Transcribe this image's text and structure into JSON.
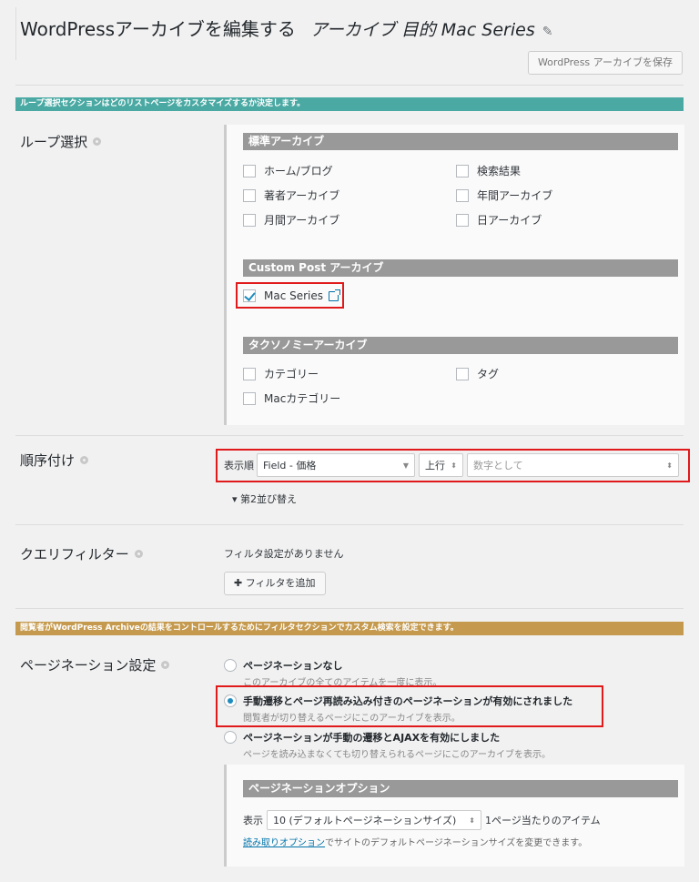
{
  "header": {
    "title": "WordPressアーカイブを編集する",
    "subtitle": "アーカイブ 目的 Mac Series",
    "save_label": "WordPress アーカイブを保存"
  },
  "banners": {
    "loop": "ループ選択セクションはどのリストページをカスタマイズするか決定します。",
    "filter": "閲覧者がWordPress Archiveの結果をコントロールするためにフィルタセクションでカスタム検索を設定できます。"
  },
  "loop": {
    "label": "ループ選択",
    "standard_head": "標準アーカイブ",
    "standard_items": [
      "ホーム/ブログ",
      "検索結果",
      "著者アーカイブ",
      "年間アーカイブ",
      "月間アーカイブ",
      "日アーカイブ"
    ],
    "custom_head": "Custom Post アーカイブ",
    "custom_item": "Mac Series",
    "taxonomy_head": "タクソノミーアーカイブ",
    "taxonomy_items": [
      "カテゴリー",
      "タグ",
      "Macカテゴリー"
    ]
  },
  "order": {
    "label": "順序付け",
    "order_by_label": "表示順",
    "field_value": "Field - 価格",
    "direction": "上行",
    "as_type": "数字として",
    "secondary_sort": "▾ 第2並び替え"
  },
  "filter": {
    "label": "クエリフィルター",
    "none_text": "フィルタ設定がありません",
    "add_label": "✚ フィルタを追加"
  },
  "pagination": {
    "label": "ページネーション設定",
    "options": [
      {
        "title": "ページネーションなし",
        "desc": "このアーカイブの全てのアイテムを一度に表示。"
      },
      {
        "title": "手動遷移とページ再読み込み付きのページネーションが有効にされました",
        "desc": "閲覧者が切り替えるページにこのアーカイブを表示。"
      },
      {
        "title": "ページネーションが手動の遷移とAJAXを有効にしました",
        "desc": "ページを読み込まなくても切り替えられるページにこのアーカイブを表示。"
      }
    ],
    "options_head": "ページネーションオプション",
    "show_label": "表示",
    "page_size": "10 (デフォルトページネーションサイズ)",
    "per_page_label": "1ページ当たりのアイテム",
    "reading_link": "読み取りオプション",
    "reading_note": "でサイトのデフォルトページネーションサイズを変更できます。"
  }
}
